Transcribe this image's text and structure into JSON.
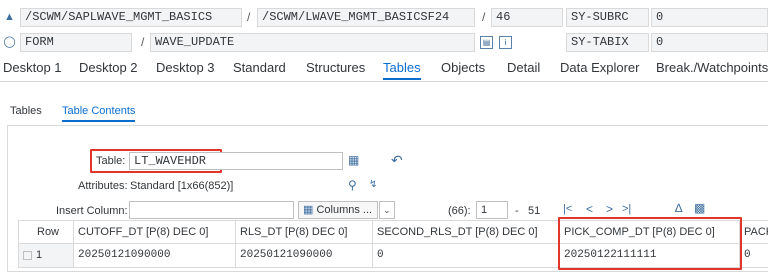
{
  "header": {
    "row1": {
      "program": "/SCWM/SAPLWAVE_MGMT_BASICS",
      "slash1": "/",
      "include": "/SCWM/LWAVE_MGMT_BASICSF24",
      "slash2": "/",
      "line": "46",
      "sysvar_name": "SY-SUBRC",
      "sysvar_value": "0"
    },
    "row2": {
      "type": "FORM",
      "slash": "/",
      "name": "WAVE_UPDATE",
      "sysvar_name": "SY-TABIX",
      "sysvar_value": "0"
    }
  },
  "tabs": [
    "Desktop 1",
    "Desktop 2",
    "Desktop 3",
    "Standard",
    "Structures",
    "Tables",
    "Objects",
    "Detail",
    "Data Explorer",
    "Break./Watchpoints"
  ],
  "active_tab": "Tables",
  "subtabs": [
    "Tables",
    "Table Contents"
  ],
  "active_subtab": "Table Contents",
  "table_section": {
    "table_label": "Table:",
    "table_value": "LT_WAVEHDR",
    "attributes_label": "Attributes:",
    "attributes_value": "Standard [1x66(852)]",
    "insert_column_label": "Insert Column:",
    "insert_column_value": "",
    "columns_button": "Columns ...",
    "row_count": "(66):",
    "from_value": "1",
    "dash": "-",
    "to_value": "51"
  },
  "grid": {
    "headers": [
      "Row",
      "CUTOFF_DT [P(8) DEC 0]",
      "RLS_DT [P(8) DEC 0]",
      "SECOND_RLS_DT [P(8) DEC 0]",
      "PICK_COMP_DT [P(8) DEC 0]",
      "PACK"
    ],
    "rows": [
      [
        "1",
        "20250121090000",
        "20250121090000",
        "0",
        "20250122111111",
        "0"
      ]
    ]
  },
  "icons": {
    "row1_icon": "program-icon",
    "row2_icon": "form-icon",
    "table_help_icon": "table-picker-icon",
    "refresh_icon": "undo-arrow-icon",
    "find_icon": "magnifier-icon",
    "expand_icon": "expand-icon",
    "nav_first": "first-page-icon",
    "nav_prev": "previous-page-icon",
    "nav_next": "next-page-icon",
    "nav_last": "last-page-icon",
    "droplet_icon": "droplet-icon",
    "save_icon": "save-icon"
  },
  "colors": {
    "accent": "#0a6ed1",
    "highlight_frame": "#e2362b"
  }
}
